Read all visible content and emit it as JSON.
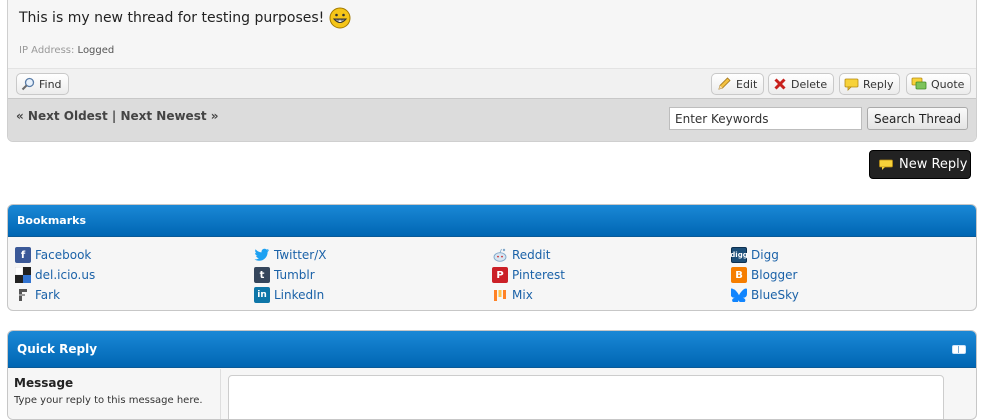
{
  "post": {
    "message": "This is my new thread for testing purposes!",
    "ip_label": "IP Address:",
    "ip_value": "Logged",
    "buttons": {
      "find": "Find",
      "edit": "Edit",
      "delete": "Delete",
      "reply": "Reply",
      "quote": "Quote"
    }
  },
  "thread_nav": {
    "next_oldest": "« Next Oldest",
    "separator": "|",
    "next_newest": "Next Newest »",
    "search_placeholder": "Enter Keywords",
    "search_button": "Search Thread"
  },
  "new_reply_label": "New Reply",
  "bookmarks": {
    "title": "Bookmarks",
    "items": [
      {
        "label": "Facebook",
        "icon": "facebook-icon",
        "color": "#3b5998"
      },
      {
        "label": "del.icio.us",
        "icon": "delicious-icon",
        "color": "#000000"
      },
      {
        "label": "Fark",
        "icon": "fark-icon",
        "color": "#555555"
      },
      {
        "label": "Twitter/X",
        "icon": "twitter-icon",
        "color": "#1da1f2"
      },
      {
        "label": "Tumblr",
        "icon": "tumblr-icon",
        "color": "#35465c"
      },
      {
        "label": "LinkedIn",
        "icon": "linkedin-icon",
        "color": "#0e76a8"
      },
      {
        "label": "Reddit",
        "icon": "reddit-icon",
        "color": "#7fa7c9"
      },
      {
        "label": "Pinterest",
        "icon": "pinterest-icon",
        "color": "#cb2027"
      },
      {
        "label": "Mix",
        "icon": "mix-icon",
        "color": "#ff8226"
      },
      {
        "label": "Digg",
        "icon": "digg-icon",
        "color": "#1d4f79"
      },
      {
        "label": "Blogger",
        "icon": "blogger-icon",
        "color": "#f57d00"
      },
      {
        "label": "BlueSky",
        "icon": "bluesky-icon",
        "color": "#1185fe"
      }
    ]
  },
  "quick_reply": {
    "title": "Quick Reply",
    "message_label": "Message",
    "message_hint": "Type your reply to this message here."
  },
  "colors": {
    "header_blue": "#0a74c4",
    "link_blue": "#1b62a8",
    "new_reply_bg": "#222222"
  }
}
